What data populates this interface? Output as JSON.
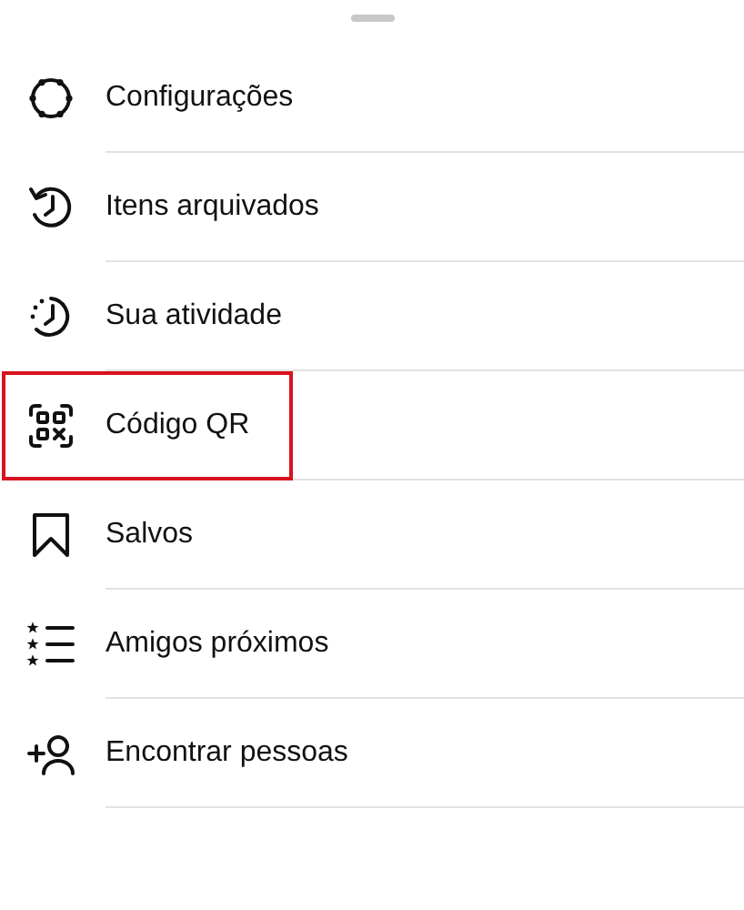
{
  "items": [
    {
      "label": "Configurações",
      "highlighted": false
    },
    {
      "label": "Itens arquivados",
      "highlighted": false
    },
    {
      "label": "Sua atividade",
      "highlighted": false
    },
    {
      "label": "Código QR",
      "highlighted": true
    },
    {
      "label": "Salvos",
      "highlighted": false
    },
    {
      "label": "Amigos próximos",
      "highlighted": false
    },
    {
      "label": "Encontrar pessoas",
      "highlighted": false
    }
  ]
}
